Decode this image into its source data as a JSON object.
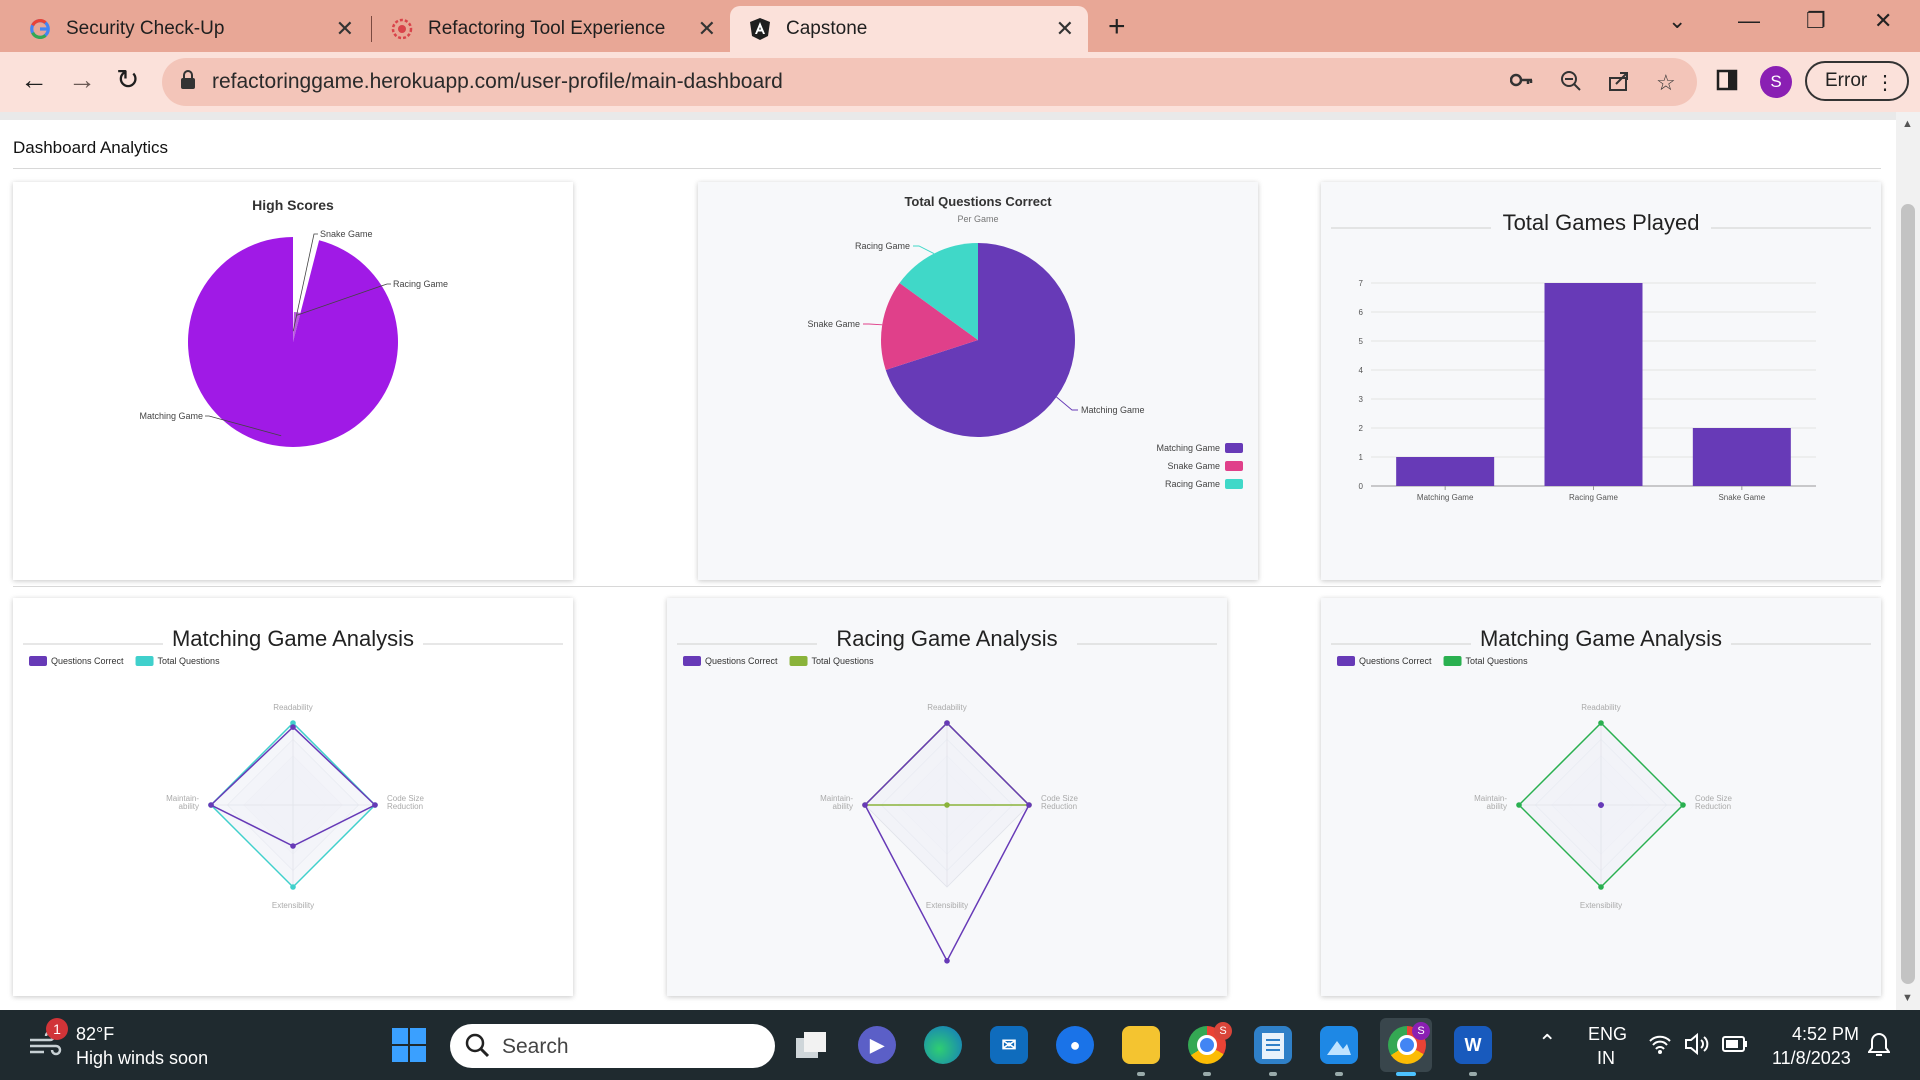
{
  "browser": {
    "tabs": [
      {
        "title": "Security Check-Up",
        "icon": "google-icon"
      },
      {
        "title": "Refactoring Tool Experience",
        "icon": "refactor-app-icon"
      },
      {
        "title": "Capstone",
        "icon": "angular-icon",
        "active": true
      }
    ],
    "url": "refactoringgame.herokuapp.com/user-profile/main-dashboard",
    "profile_initial": "S",
    "error_label": "Error"
  },
  "page": {
    "section_title": "Dashboard Analytics"
  },
  "charts": {
    "high_scores": {
      "title": "High Scores"
    },
    "questions_correct": {
      "title": "Total Questions Correct",
      "subtitle": "Per Game"
    },
    "games_played": {
      "title": "Total Games Played"
    },
    "matching_analysis": {
      "title": "Matching Game Analysis"
    },
    "racing_analysis": {
      "title": "Racing Game Analysis"
    },
    "matching_analysis_2": {
      "title": "Matching Game Analysis"
    }
  },
  "chart_data": [
    {
      "type": "pie",
      "title": "High Scores",
      "labels": [
        "Matching Game",
        "Racing Game",
        "Snake Game"
      ],
      "values": [
        96,
        3.5,
        0.5
      ],
      "colors": [
        "#a01ae6",
        "#b95ae0",
        "#c98ae8"
      ]
    },
    {
      "type": "pie",
      "title": "Total Questions Correct",
      "subtitle": "Per Game",
      "labels": [
        "Matching Game",
        "Snake Game",
        "Racing Game"
      ],
      "values": [
        70,
        15,
        15
      ],
      "colors": [
        "#673ab7",
        "#e0408a",
        "#40d8c8"
      ],
      "legend": "bottom-right"
    },
    {
      "type": "bar",
      "title": "Total Games Played",
      "categories": [
        "Matching Game",
        "Racing Game",
        "Snake Game"
      ],
      "values": [
        1,
        7,
        2
      ],
      "ylim": [
        0,
        7
      ],
      "yticks": [
        0,
        1,
        2,
        3,
        4,
        5,
        6,
        7
      ],
      "color": "#673ab7",
      "grid": true
    },
    {
      "type": "radar",
      "title": "Matching Game Analysis",
      "axes": [
        "Readability",
        "Code Size\nReduction",
        "Extensibility",
        "Maintain-\nability"
      ],
      "axis_labels": [
        [
          "Readability"
        ],
        [
          "Code Size",
          "Reduction"
        ],
        [
          "Extensibility"
        ],
        [
          "Maintain-",
          "ability"
        ]
      ],
      "rmax": 1,
      "series": [
        {
          "name": "Questions Correct",
          "values": [
            0.95,
            1,
            0.5,
            1
          ],
          "color": "#673ab7"
        },
        {
          "name": "Total Questions",
          "values": [
            1,
            1,
            1,
            1
          ],
          "color": "#40d0cc"
        }
      ],
      "legend": "top-left"
    },
    {
      "type": "radar",
      "title": "Racing Game Analysis",
      "axes": [
        "Readability",
        "Code Size\nReduction",
        "Extensibility",
        "Maintain-\nability"
      ],
      "axis_labels": [
        [
          "Readability"
        ],
        [
          "Code Size",
          "Reduction"
        ],
        [
          "Extensibility"
        ],
        [
          "Maintain-",
          "ability"
        ]
      ],
      "rmax": 1,
      "series": [
        {
          "name": "Questions Correct",
          "values": [
            1,
            1,
            1.9,
            1
          ],
          "color": "#673ab7"
        },
        {
          "name": "Total Questions",
          "values": [
            1,
            1,
            0,
            1
          ],
          "color": "#8ab33a"
        }
      ],
      "legend": "top-left"
    },
    {
      "type": "radar",
      "title": "Matching Game Analysis",
      "axes": [
        "Readability",
        "Code Size\nReduction",
        "Extensibility",
        "Maintain-\nability"
      ],
      "axis_labels": [
        [
          "Readability"
        ],
        [
          "Code Size",
          "Reduction"
        ],
        [
          "Extensibility"
        ],
        [
          "Maintain-",
          "ability"
        ]
      ],
      "rmax": 1,
      "series": [
        {
          "name": "Questions Correct",
          "values": [
            0,
            0,
            0,
            0
          ],
          "color": "#673ab7"
        },
        {
          "name": "Total Questions",
          "values": [
            1,
            1,
            1,
            1
          ],
          "color": "#2ab050"
        }
      ],
      "legend": "top-left"
    }
  ],
  "taskbar": {
    "weather_temp": "82°F",
    "weather_desc": "High winds soon",
    "weather_badge": "1",
    "search_placeholder": "Search",
    "lang_line1": "ENG",
    "lang_line2": "IN",
    "time": "4:52 PM",
    "date": "11/8/2023",
    "chrome_badge": "S",
    "chrome2_badge": "S",
    "word_label": "W"
  }
}
